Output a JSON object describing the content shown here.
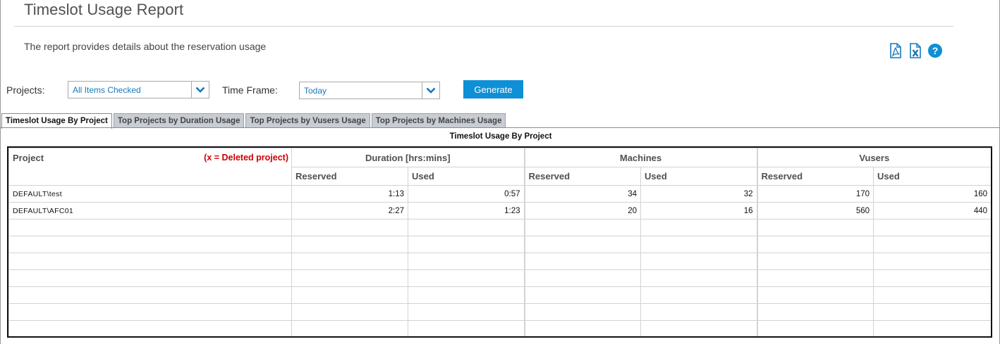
{
  "page": {
    "title": "Timeslot Usage Report",
    "description": "The report provides details about the reservation usage"
  },
  "icons": [
    "pdf-export-icon",
    "excel-export-icon",
    "help-icon"
  ],
  "filters": {
    "projects_label": "Projects:",
    "projects_value": "All Items Checked",
    "timeframe_label": "Time Frame:",
    "timeframe_value": "Today",
    "generate_label": "Generate"
  },
  "tabs": [
    {
      "label": "Timeslot Usage By Project",
      "active": true
    },
    {
      "label": "Top Projects by Duration Usage",
      "active": false
    },
    {
      "label": "Top Projects by Vusers Usage",
      "active": false
    },
    {
      "label": "Top Projects by Machines Usage",
      "active": false
    }
  ],
  "report": {
    "title": "Timeslot Usage By Project",
    "project_header": "Project",
    "deleted_note": "(x = Deleted project)",
    "groups": [
      "Duration [hrs:mins]",
      "Machines",
      "Vusers"
    ],
    "subheaders": [
      "Reserved",
      "Used",
      "Reserved",
      "Used",
      "Reserved",
      "Used"
    ],
    "rows": [
      {
        "project": "DEFAULT\\test",
        "values": [
          "1:13",
          "0:57",
          "34",
          "32",
          "170",
          "160"
        ]
      },
      {
        "project": "DEFAULT\\AFC01",
        "values": [
          "2:27",
          "1:23",
          "20",
          "16",
          "560",
          "440"
        ]
      }
    ]
  },
  "colors": {
    "accent": "#0e8fd6",
    "link_text": "#1a78b8",
    "deleted_note": "#d00000"
  }
}
